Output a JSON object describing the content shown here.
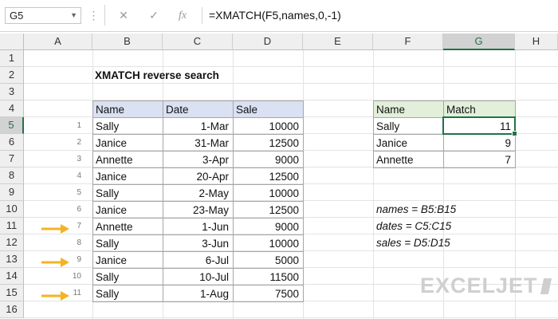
{
  "name_box": "G5",
  "formula_buttons": {
    "cancel": "✕",
    "enter": "✓",
    "fx": "fx"
  },
  "formula": "=XMATCH(F5,names,0,-1)",
  "columns": [
    "A",
    "B",
    "C",
    "D",
    "E",
    "F",
    "G",
    "H"
  ],
  "rows": [
    "1",
    "2",
    "3",
    "4",
    "5",
    "6",
    "7",
    "8",
    "9",
    "10",
    "11",
    "12",
    "13",
    "14",
    "15",
    "16"
  ],
  "title": "XMATCH reverse search",
  "table": {
    "headers": [
      "Name",
      "Date",
      "Sale"
    ],
    "rows": [
      {
        "idx": "1",
        "name": "Sally",
        "date": "1-Mar",
        "sale": "10000"
      },
      {
        "idx": "2",
        "name": "Janice",
        "date": "31-Mar",
        "sale": "12500"
      },
      {
        "idx": "3",
        "name": "Annette",
        "date": "3-Apr",
        "sale": "9000"
      },
      {
        "idx": "4",
        "name": "Janice",
        "date": "20-Apr",
        "sale": "12500"
      },
      {
        "idx": "5",
        "name": "Sally",
        "date": "2-May",
        "sale": "10000"
      },
      {
        "idx": "6",
        "name": "Janice",
        "date": "23-May",
        "sale": "12500"
      },
      {
        "idx": "7",
        "name": "Annette",
        "date": "1-Jun",
        "sale": "9000"
      },
      {
        "idx": "8",
        "name": "Sally",
        "date": "3-Jun",
        "sale": "10000"
      },
      {
        "idx": "9",
        "name": "Janice",
        "date": "6-Jul",
        "sale": "5000"
      },
      {
        "idx": "10",
        "name": "Sally",
        "date": "10-Jul",
        "sale": "11500"
      },
      {
        "idx": "11",
        "name": "Sally",
        "date": "1-Aug",
        "sale": "7500"
      }
    ]
  },
  "match_table": {
    "headers": [
      "Name",
      "Match"
    ],
    "rows": [
      {
        "name": "Sally",
        "match": "11"
      },
      {
        "name": "Janice",
        "match": "9"
      },
      {
        "name": "Annette",
        "match": "7"
      }
    ]
  },
  "named_ranges": [
    "names = B5:B15",
    "dates = C5:C15",
    "sales = D5:D15"
  ],
  "logo": "EXCELJET",
  "colors": {
    "accent": "#217346",
    "header_blue": "#d9e1f2",
    "header_green": "#e2efda",
    "arrow": "#f4b324"
  }
}
